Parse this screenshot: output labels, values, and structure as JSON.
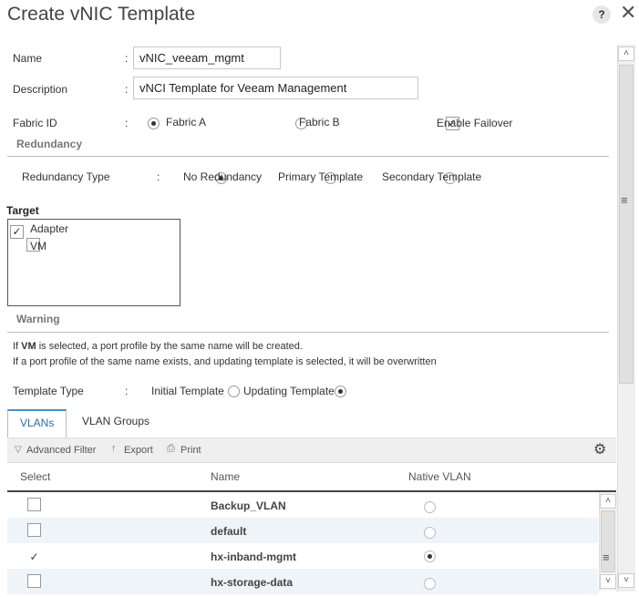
{
  "dialog": {
    "title": "Create vNIC Template",
    "help": "?",
    "close": "✕"
  },
  "form": {
    "name_label": "Name",
    "name_value": "vNIC_veeam_mgmt",
    "description_label": "Description",
    "description_value": "vNCI Template for Veeam Management",
    "fabric_label": "Fabric ID",
    "fabric_a": "Fabric A",
    "fabric_b": "Fabric B",
    "enable_failover": "Enable Failover",
    "colon": ":"
  },
  "redundancy": {
    "section": "Redundancy",
    "type_label": "Redundancy Type",
    "no_redundancy": "No Redundancy",
    "primary": "Primary Template",
    "secondary": "Secondary Template"
  },
  "target": {
    "label": "Target",
    "adapter": "Adapter",
    "vm": "VM"
  },
  "warning": {
    "section": "Warning",
    "line1_bold": "VM",
    "line1_pre": "If ",
    "line1_post": " is selected, a port profile by the same name will be created.",
    "line2": "If a port profile of the same name exists, and updating template is selected, it will be overwritten"
  },
  "template_type": {
    "label": "Template Type",
    "initial": "Initial Template",
    "updating": "Updating Template"
  },
  "tabs": [
    {
      "label": "VLANs"
    },
    {
      "label": "VLAN Groups"
    }
  ],
  "toolbar": {
    "filter": "Advanced Filter",
    "export": "Export",
    "print": "Print"
  },
  "table": {
    "headers": [
      "Select",
      "Name",
      "Native VLAN"
    ],
    "rows": [
      {
        "name": "Backup_VLAN",
        "selected": false,
        "native": false
      },
      {
        "name": "default",
        "selected": false,
        "native": false
      },
      {
        "name": "hx-inband-mgmt",
        "selected": true,
        "native": true
      },
      {
        "name": "hx-storage-data",
        "selected": false,
        "native": false
      }
    ]
  },
  "icons": {
    "check": "✓",
    "up": "˄",
    "down": "˅",
    "menu": "≡",
    "gear": "⚙"
  }
}
